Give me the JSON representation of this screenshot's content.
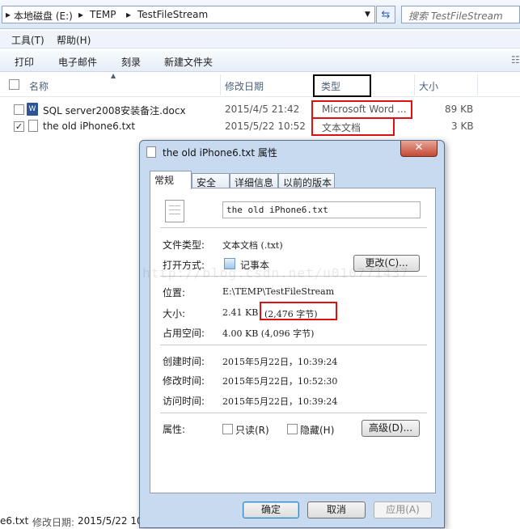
{
  "explorer": {
    "breadcrumb": [
      "本地磁盘 (E:)",
      "TEMP",
      "TestFileStream"
    ],
    "search_placeholder": "搜索 TestFileStream",
    "menu": [
      "工具(T)",
      "帮助(H)"
    ],
    "commands": [
      "打印",
      "电子邮件",
      "刻录",
      "新建文件夹"
    ],
    "columns": {
      "name": "名称",
      "modified": "修改日期",
      "type": "类型",
      "size": "大小"
    },
    "files": [
      {
        "name": "SQL server2008安装备注.docx",
        "modified": "2015/4/5 21:42",
        "type": "Microsoft Word ...",
        "size": "89 KB",
        "checked": false,
        "icon": "word-doc-icon"
      },
      {
        "name": "the old iPhone6.txt",
        "modified": "2015/5/22 10:52",
        "type": "文本文档",
        "size": "3 KB",
        "checked": true,
        "icon": "text-file-icon"
      }
    ],
    "status": {
      "name_fragment": "e6.txt",
      "modified_label": "修改日期:",
      "modified_value": "2015/5/22 10"
    }
  },
  "dialog": {
    "title": "the old iPhone6.txt 属性",
    "close_label": "✕",
    "tabs": [
      "常规",
      "安全",
      "详细信息",
      "以前的版本"
    ],
    "filename": "the old iPhone6.txt",
    "file_type_label": "文件类型:",
    "file_type_value": "文本文档 (.txt)",
    "open_with_label": "打开方式:",
    "open_with_value": "记事本",
    "change_button": "更改(C)...",
    "location_label": "位置:",
    "location_value": "E:\\TEMP\\TestFileStream",
    "size_label": "大小:",
    "size_value": "2.41 KB",
    "size_bytes": "(2,476 字节)",
    "disk_size_label": "占用空间:",
    "disk_size_value": "4.00 KB (4,096 字节)",
    "created_label": "创建时间:",
    "created_value": "2015年5月22日，10:39:24",
    "modified_label": "修改时间:",
    "modified_value": "2015年5月22日，10:52:30",
    "accessed_label": "访问时间:",
    "accessed_value": "2015年5月22日，10:39:24",
    "attributes_label": "属性:",
    "readonly_label": "只读(R)",
    "hidden_label": "隐藏(H)",
    "advanced_button": "高级(D)...",
    "ok_button": "确定",
    "cancel_button": "取消",
    "apply_button": "应用(A)",
    "watermark": "http://blog.csdn.net/u010771437"
  },
  "colors": {
    "highlight_box": "#e01010"
  }
}
